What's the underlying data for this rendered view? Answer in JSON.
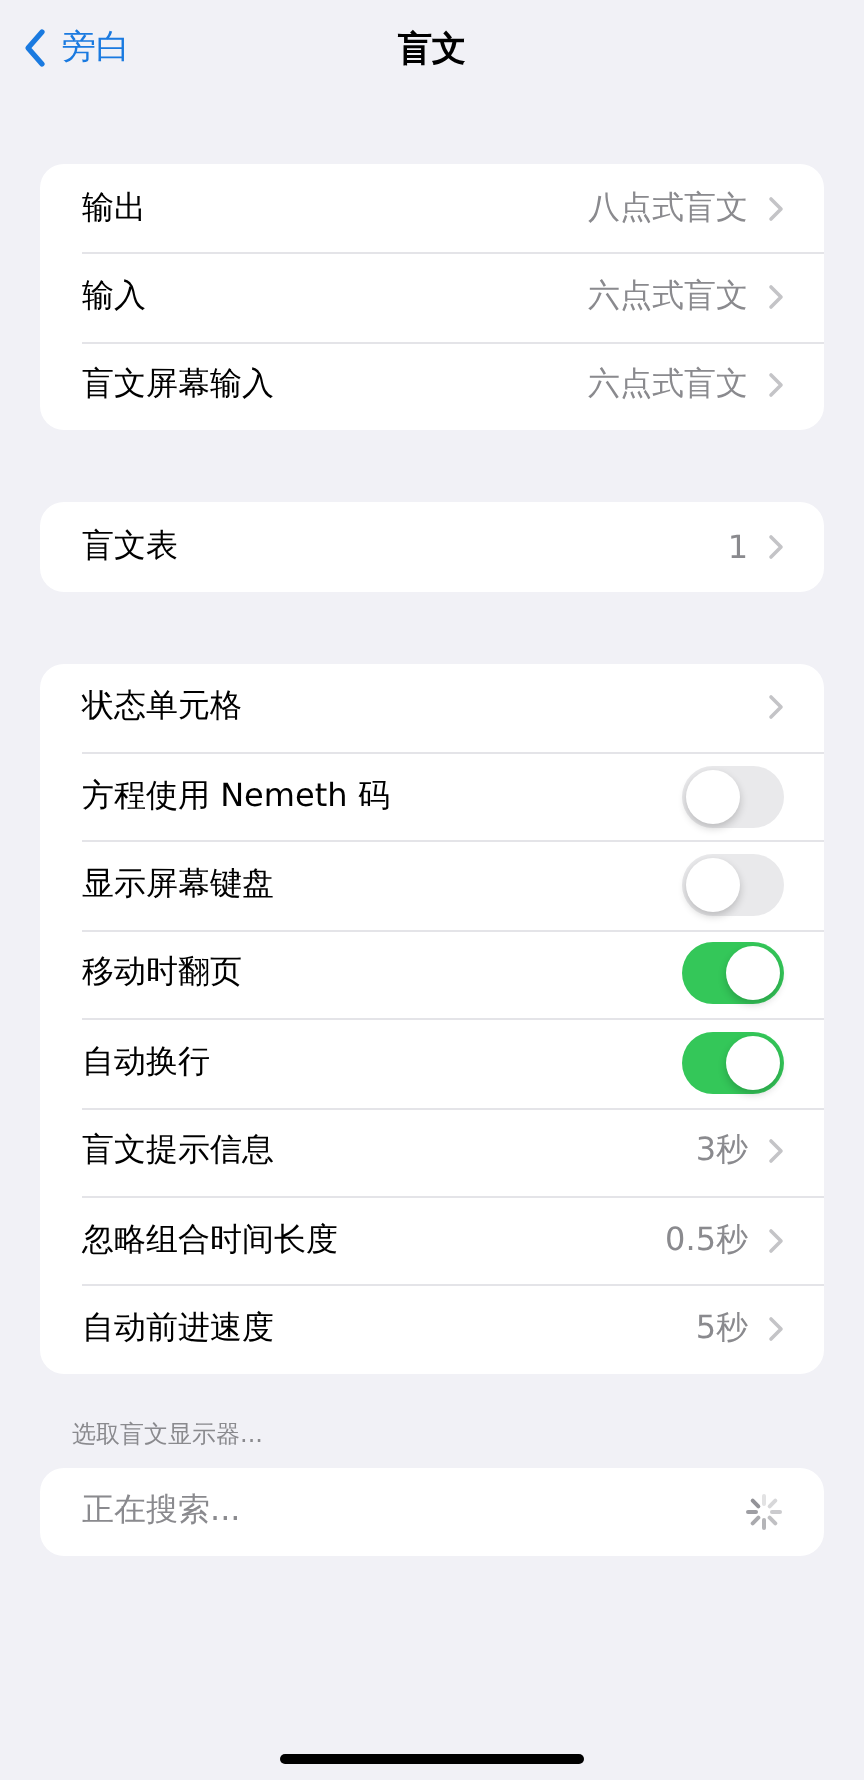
{
  "nav": {
    "back": "旁白",
    "title": "盲文"
  },
  "groups": [
    {
      "rows": [
        {
          "kind": "link",
          "label": "输出",
          "value": "八点式盲文"
        },
        {
          "kind": "link",
          "label": "输入",
          "value": "六点式盲文"
        },
        {
          "kind": "link",
          "label": "盲文屏幕输入",
          "value": "六点式盲文"
        }
      ]
    },
    {
      "rows": [
        {
          "kind": "link",
          "label": "盲文表",
          "value": "1"
        }
      ]
    },
    {
      "rows": [
        {
          "kind": "link",
          "label": "状态单元格"
        },
        {
          "kind": "toggle",
          "label": "方程使用 Nemeth 码",
          "on": false
        },
        {
          "kind": "toggle",
          "label": "显示屏幕键盘",
          "on": false
        },
        {
          "kind": "toggle",
          "label": "移动时翻页",
          "on": true
        },
        {
          "kind": "toggle",
          "label": "自动换行",
          "on": true
        },
        {
          "kind": "link",
          "label": "盲文提示信息",
          "value": "3秒"
        },
        {
          "kind": "link",
          "label": "忽略组合时间长度",
          "value": "0.5秒"
        },
        {
          "kind": "link",
          "label": "自动前进速度",
          "value": "5秒"
        }
      ]
    }
  ],
  "display_section": {
    "header": "选取盲文显示器...",
    "status": "正在搜索..."
  }
}
